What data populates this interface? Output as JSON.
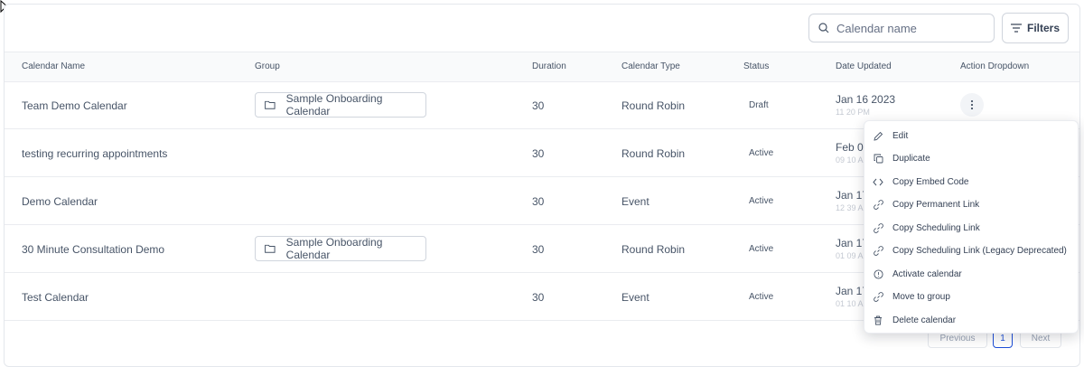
{
  "search": {
    "placeholder": "Calendar name"
  },
  "filters_label": "Filters",
  "columns": [
    "Calendar Name",
    "Group",
    "Duration",
    "Calendar Type",
    "Status",
    "Date Updated",
    "Action Dropdown"
  ],
  "rows": [
    {
      "name": "Team Demo Calendar",
      "group": "Sample Onboarding Calendar",
      "duration": "30",
      "type": "Round Robin",
      "status": "Draft",
      "date": "Jan 16 2023",
      "time": "11 20 PM"
    },
    {
      "name": "testing recurring appointments",
      "group": "",
      "duration": "30",
      "type": "Round Robin",
      "status": "Active",
      "date": "Feb 07",
      "time": "09 10 A"
    },
    {
      "name": "Demo Calendar",
      "group": "",
      "duration": "30",
      "type": "Event",
      "status": "Active",
      "date": "Jan 17",
      "time": "12 39 A"
    },
    {
      "name": "30 Minute Consultation Demo",
      "group": "Sample Onboarding Calendar",
      "duration": "30",
      "type": "Round Robin",
      "status": "Active",
      "date": "Jan 17",
      "time": "01 09 A"
    },
    {
      "name": "Test Calendar",
      "group": "",
      "duration": "30",
      "type": "Event",
      "status": "Active",
      "date": "Jan 17",
      "time": "01 10 A"
    }
  ],
  "menu": [
    {
      "label": "Edit",
      "icon": "pencil-icon"
    },
    {
      "label": "Duplicate",
      "icon": "copy-icon"
    },
    {
      "label": "Copy Embed Code",
      "icon": "code-icon"
    },
    {
      "label": "Copy Permanent Link",
      "icon": "link-icon"
    },
    {
      "label": "Copy Scheduling Link",
      "icon": "link-icon"
    },
    {
      "label": "Copy Scheduling Link (Legacy Deprecated)",
      "icon": "link-icon"
    },
    {
      "label": "Activate calendar",
      "icon": "alert-circle-icon"
    },
    {
      "label": "Move to group",
      "icon": "link-icon"
    },
    {
      "label": "Delete calendar",
      "icon": "trash-icon"
    }
  ],
  "pagination": {
    "previous": "Previous",
    "current": "1",
    "next": "Next"
  }
}
